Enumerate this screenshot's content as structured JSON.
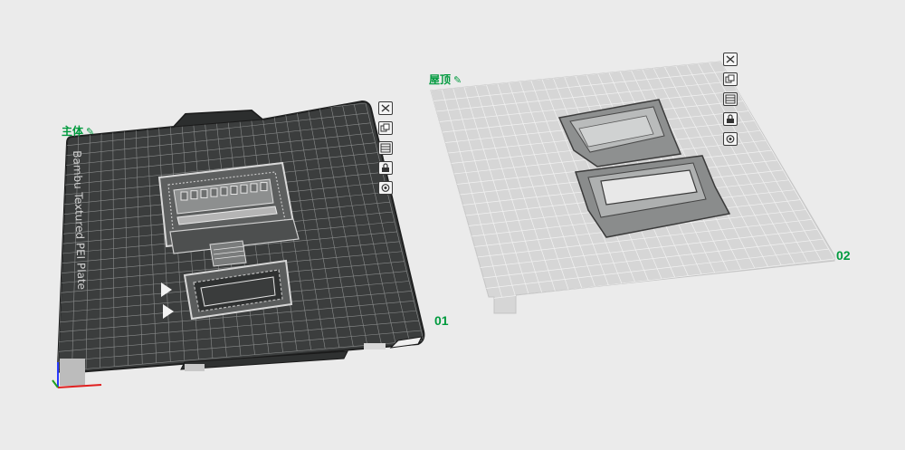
{
  "plates": [
    {
      "name": "主体",
      "number": "01",
      "plate_text": "Bambu Textured PEI Plate",
      "toolbar": [
        "close-icon",
        "copy-icon",
        "layout-icon",
        "lock-icon",
        "settings-icon"
      ]
    },
    {
      "name": "屋顶",
      "number": "02",
      "toolbar": [
        "close-icon",
        "copy-icon",
        "layout-icon",
        "lock-icon",
        "settings-icon"
      ]
    }
  ],
  "edit_icon": "✎",
  "colors": {
    "accent": "#009a3e",
    "plate_dark": "#3b3d3d",
    "plate_light": "#d6d6d6",
    "background": "#ebebeb"
  }
}
